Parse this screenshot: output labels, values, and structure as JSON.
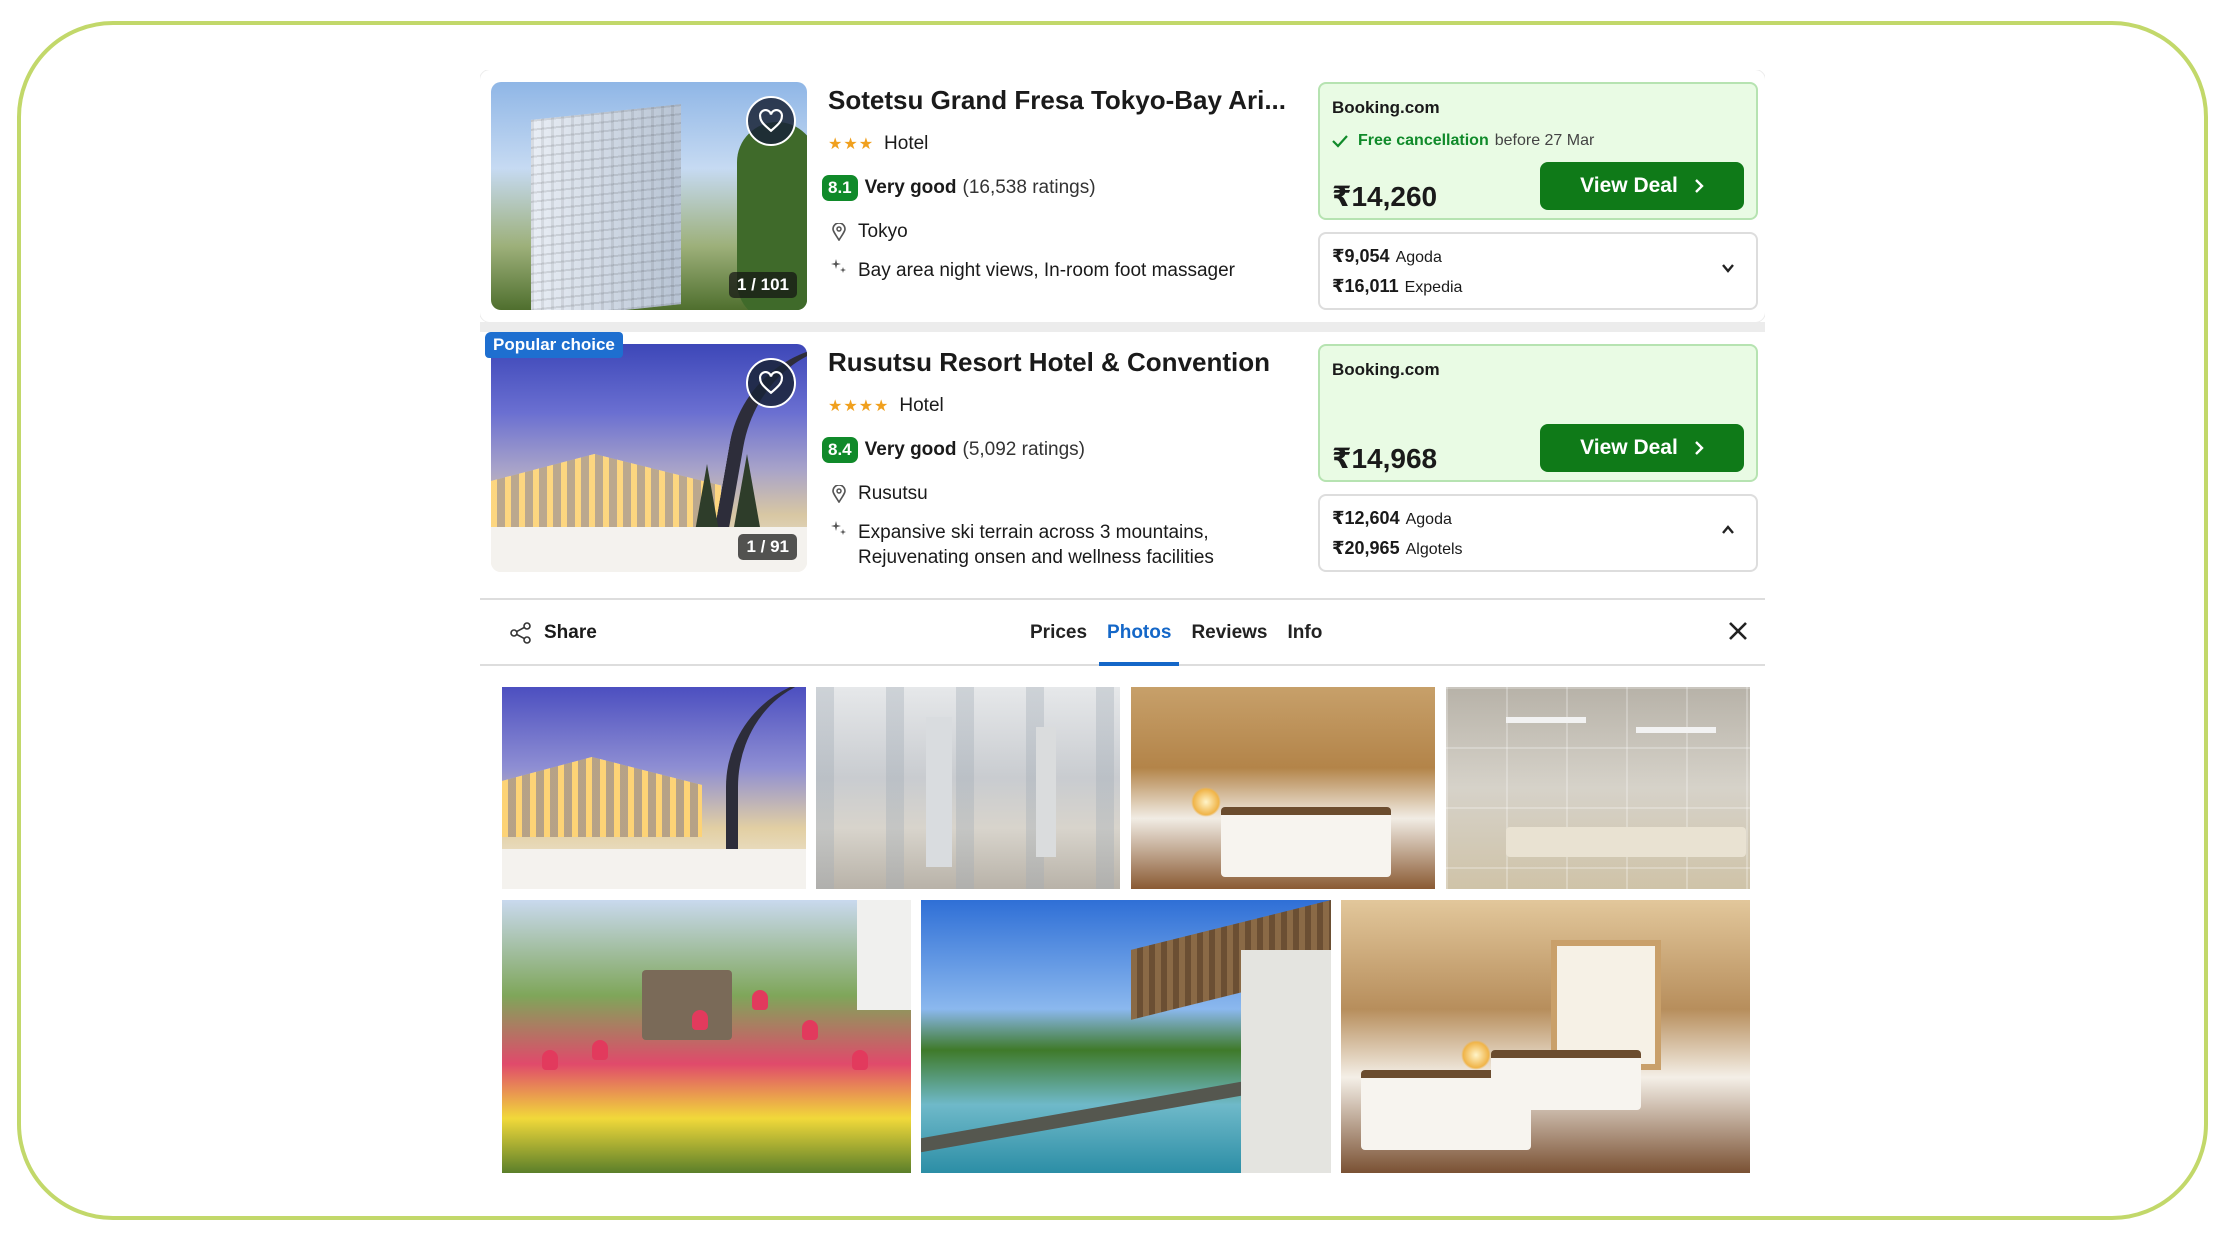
{
  "hotels": [
    {
      "name": "Sotetsu Grand Fresa Tokyo-Bay Ari...",
      "stars": "★★★",
      "type": "Hotel",
      "score": "8.1",
      "rating_label": "Very good",
      "ratings_count": "(16,538 ratings)",
      "location": "Tokyo",
      "amenities": [
        "Bay area night views, In-room foot massager"
      ],
      "photo_counter": "1 / 101",
      "deal": {
        "site": "Booking.com",
        "cancel_label": "Free cancellation",
        "cancel_date": "before 27 Mar",
        "price": "₹14,260",
        "button_label": "View Deal"
      },
      "alternatives": [
        {
          "price": "₹9,054",
          "site": "Agoda"
        },
        {
          "price": "₹16,011",
          "site": "Expedia"
        }
      ],
      "expanded": false
    },
    {
      "name": "Rusutsu Resort Hotel & Convention",
      "badge": "Popular choice",
      "stars": "★★★★",
      "type": "Hotel",
      "score": "8.4",
      "rating_label": "Very good",
      "ratings_count": "(5,092 ratings)",
      "location": "Rusutsu",
      "amenities": [
        "Expansive ski terrain across 3 mountains,",
        "Rejuvenating onsen and wellness facilities"
      ],
      "photo_counter": "1 / 91",
      "deal": {
        "site": "Booking.com",
        "price": "₹14,968",
        "button_label": "View Deal"
      },
      "alternatives": [
        {
          "price": "₹12,604",
          "site": "Agoda"
        },
        {
          "price": "₹20,965",
          "site": "Algotels"
        }
      ],
      "expanded": true
    }
  ],
  "details": {
    "share_label": "Share",
    "tabs": [
      {
        "label": "Prices",
        "active": false
      },
      {
        "label": "Photos",
        "active": true
      },
      {
        "label": "Reviews",
        "active": false
      },
      {
        "label": "Info",
        "active": false
      }
    ]
  },
  "colors": {
    "score_green": "#108a2a",
    "deal_button": "#0f7a18",
    "deal_background": "#e9fbe4",
    "active_tab": "#1467c8",
    "popular_badge": "#1e6fd0",
    "star": "#f0a01e",
    "frame_border": "#c2d86a"
  },
  "icons": [
    "heart-icon",
    "pin-icon",
    "sparkle-icon",
    "check-icon",
    "chevron-right-icon",
    "chevron-down-icon",
    "chevron-up-icon",
    "share-icon",
    "close-icon"
  ]
}
